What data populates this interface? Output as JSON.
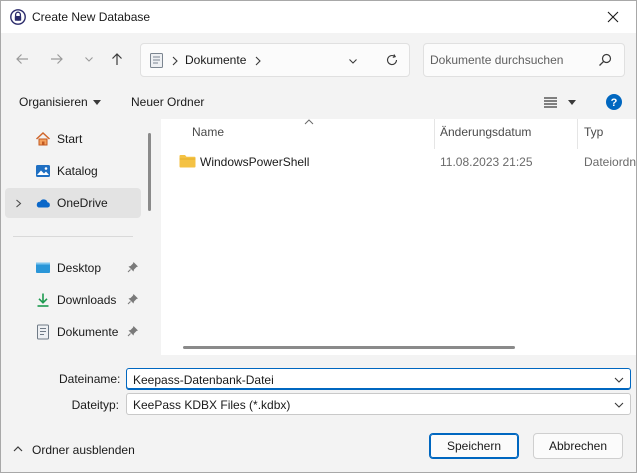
{
  "window": {
    "title": "Create New Database"
  },
  "nav": {
    "back_icon": "arrow-left-icon",
    "forward_icon": "arrow-right-icon",
    "recent_icon": "chevron-down-icon",
    "up_icon": "arrow-up-icon",
    "breadcrumb": [
      "Dokumente"
    ],
    "search_placeholder": "Dokumente durchsuchen"
  },
  "commandbar": {
    "organize": "Organisieren",
    "new_folder": "Neuer Ordner"
  },
  "sidebar": {
    "items": [
      {
        "label": "Start",
        "icon": "home-icon"
      },
      {
        "label": "Katalog",
        "icon": "gallery-icon"
      },
      {
        "label": "OneDrive",
        "icon": "cloud-icon",
        "selected": true
      },
      {
        "label": "Desktop",
        "icon": "desktop-icon",
        "pinned": true
      },
      {
        "label": "Downloads",
        "icon": "download-icon",
        "pinned": true
      },
      {
        "label": "Dokumente",
        "icon": "documents-icon",
        "pinned": true
      }
    ]
  },
  "filelist": {
    "columns": [
      "Name",
      "Änderungsdatum",
      "Typ"
    ],
    "rows": [
      {
        "name": "WindowsPowerShell",
        "date": "11.08.2023 21:25",
        "type": "Dateiordn"
      }
    ]
  },
  "form": {
    "filename_label": "Dateiname:",
    "filename_value": "Keepass-Datenbank-Datei",
    "filetype_label": "Dateityp:",
    "filetype_value": "KeePass KDBX Files (*.kdbx)"
  },
  "footer": {
    "hide_folders": "Ordner ausblenden",
    "save": "Speichern",
    "cancel": "Abbrechen"
  },
  "colors": {
    "accent": "#0067c0",
    "help": "#0067c0",
    "folder": "#f4c244"
  }
}
